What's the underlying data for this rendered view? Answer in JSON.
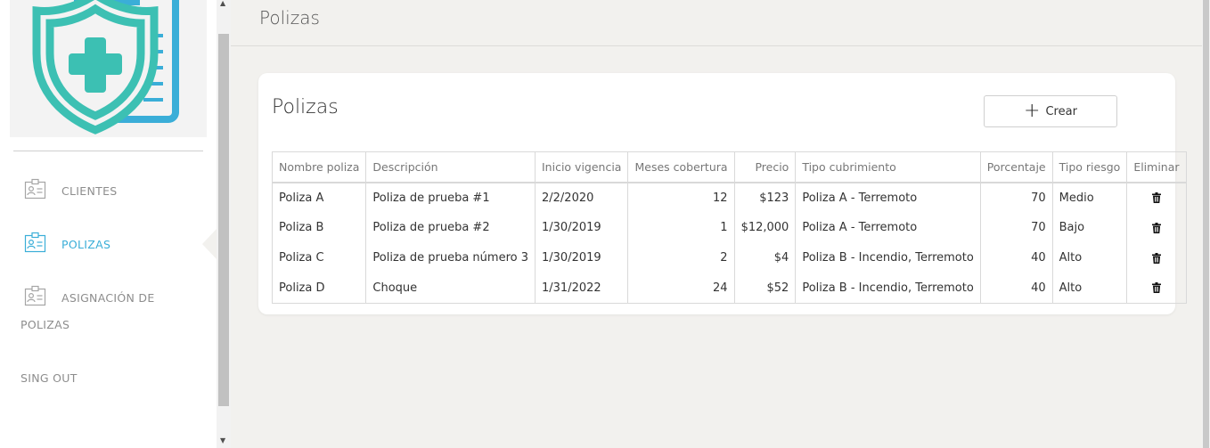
{
  "sidebar": {
    "items": [
      {
        "label": "CLIENTES",
        "active": false
      },
      {
        "label": "POLIZAS",
        "active": true
      },
      {
        "label_line1": "ASIGNACIÓN DE",
        "label_line2": "POLIZAS",
        "active": false
      }
    ],
    "signout_label": "SING OUT",
    "accent_color": "#3aaed8",
    "logo_color": "#3cc0b3"
  },
  "header": {
    "title": "Polizas"
  },
  "card": {
    "title": "Polizas",
    "create_button_label": "Crear"
  },
  "table": {
    "columns": [
      "Nombre poliza",
      "Descripción",
      "Inicio vigencia",
      "Meses cobertura",
      "Precio",
      "Tipo cubrimiento",
      "Porcentaje",
      "Tipo riesgo",
      "Eliminar"
    ],
    "rows": [
      {
        "nombre": "Poliza A",
        "descripcion": "Poliza de prueba #1",
        "inicio": "2/2/2020",
        "meses": "12",
        "precio": "$123",
        "tipo": "Poliza A - Terremoto",
        "porcentaje": "70",
        "riesgo": "Medio"
      },
      {
        "nombre": "Poliza B",
        "descripcion": "Poliza de prueba #2",
        "inicio": "1/30/2019",
        "meses": "1",
        "precio": "$12,000",
        "tipo": "Poliza A - Terremoto",
        "porcentaje": "70",
        "riesgo": "Bajo"
      },
      {
        "nombre": "Poliza C",
        "descripcion": "Poliza de prueba número 3",
        "inicio": "1/30/2019",
        "meses": "2",
        "precio": "$4",
        "tipo": "Poliza B - Incendio, Terremoto",
        "porcentaje": "40",
        "riesgo": "Alto"
      },
      {
        "nombre": "Poliza D",
        "descripcion": "Choque",
        "inicio": "1/31/2022",
        "meses": "24",
        "precio": "$52",
        "tipo": "Poliza B - Incendio, Terremoto",
        "porcentaje": "40",
        "riesgo": "Alto"
      }
    ]
  }
}
